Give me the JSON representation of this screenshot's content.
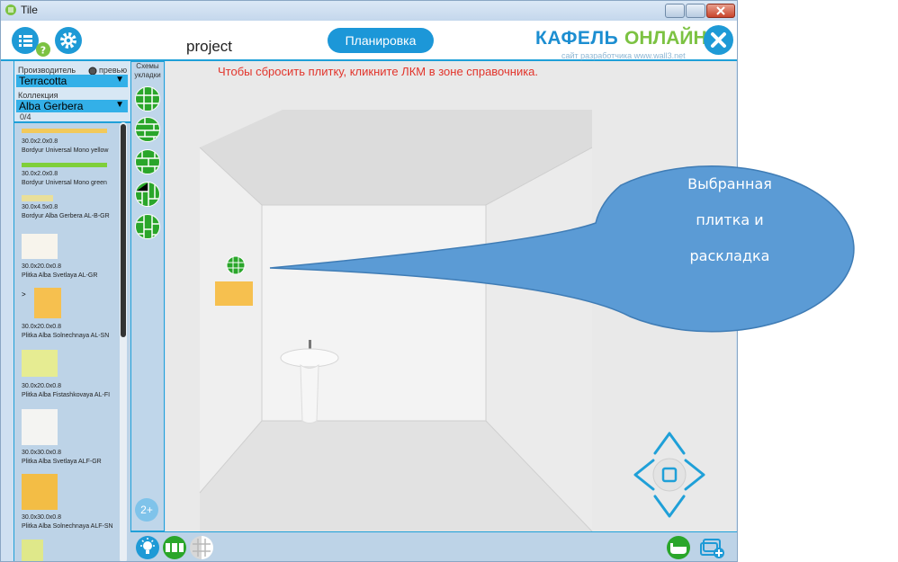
{
  "window": {
    "title": "Tile"
  },
  "header": {
    "project_name": "project",
    "plan_button": "Планировка",
    "brand_part1": "КАФЕЛЬ",
    "brand_part2": "ОНЛАЙН",
    "brand_subtitle": "сайт разработчика www.wall3.net"
  },
  "filters": {
    "manufacturer_label": "Производитель",
    "preview_label": "превью",
    "manufacturer_value": "Terracotta",
    "collection_label": "Коллекция",
    "collection_value": "Alba Gerbera",
    "count": "0/4"
  },
  "tiles": [
    {
      "size": "30.0x2.0x0.8",
      "name": "Bordyur Universal Mono yellow",
      "color": "#f2c95a"
    },
    {
      "size": "30.0x2.0x0.8",
      "name": "Bordyur Universal Mono green",
      "color": "#7fcf3a"
    },
    {
      "size": "30.0x4.5x0.8",
      "name": "Bordyur Alba Gerbera AL-B-GR",
      "color": "#e9df9a"
    },
    {
      "size": "30.0x20.0x0.8",
      "name": "Plitka Alba Svetlaya AL-GR",
      "color": "#f7f4ec"
    },
    {
      "size": "30.0x20.0x0.8",
      "name": "Plitka Alba Solnechnaya AL-SN",
      "color": "#f6c04f",
      "selected_marker": ">"
    },
    {
      "size": "30.0x20.0x0.8",
      "name": "Plitka Alba Fistashkovaya AL-FI",
      "color": "#e6ec92"
    },
    {
      "size": "30.0x30.0x0.8",
      "name": "Plitka Alba Svetlaya ALF-GR",
      "color": "#f4f4f2"
    },
    {
      "size": "30.0x30.0x0.8",
      "name": "Plitka Alba Solnechnaya ALF-SN",
      "color": "#f3bd45"
    },
    {
      "size": "",
      "name": "",
      "color": "#dfe88a"
    }
  ],
  "schemes": {
    "label": "Схемы укладки",
    "more_label": "2+"
  },
  "viewport": {
    "hint": "Чтобы сбросить плитку, кликните ЛКМ в зоне справочника.",
    "selected_tile_color": "#f6c04f"
  },
  "callout": {
    "line1": "Выбранная",
    "line2": "плитка и",
    "line3": "раскладка",
    "color": "#5b9bd5"
  },
  "colors": {
    "accent": "#1c97d8",
    "scheme_green": "#2aa62a",
    "hint_red": "#e2342b"
  }
}
